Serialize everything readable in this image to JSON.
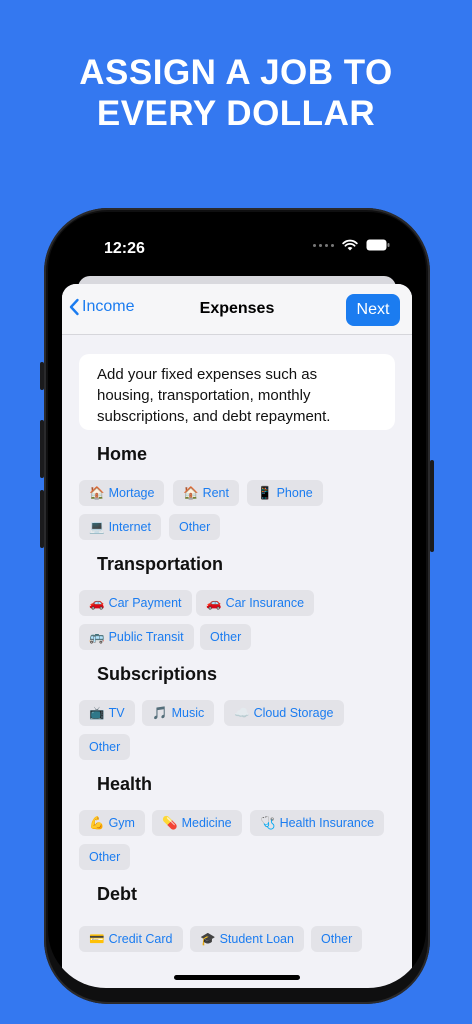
{
  "headline": {
    "line1": "ASSIGN A JOB TO",
    "line2": "EVERY DOLLAR"
  },
  "status_bar": {
    "time": "12:26"
  },
  "nav": {
    "back_label": "Income",
    "title": "Expenses",
    "next_label": "Next"
  },
  "intro_text": "Add your fixed expenses such as housing, transportation, monthly subscriptions, and debt repayment.",
  "sections": [
    {
      "title": "Home",
      "chips": [
        {
          "icon": "🏠",
          "label": "Mortage"
        },
        {
          "icon": "🏠",
          "label": "Rent"
        },
        {
          "icon": "📱",
          "label": "Phone"
        },
        {
          "icon": "💻",
          "label": "Internet"
        },
        {
          "icon": "",
          "label": "Other"
        }
      ]
    },
    {
      "title": "Transportation",
      "chips": [
        {
          "icon": "🚗",
          "label": "Car Payment"
        },
        {
          "icon": "🚗",
          "label": "Car Insurance"
        },
        {
          "icon": "🚌",
          "label": "Public Transit"
        },
        {
          "icon": "",
          "label": "Other"
        }
      ]
    },
    {
      "title": "Subscriptions",
      "chips": [
        {
          "icon": "📺",
          "label": "TV"
        },
        {
          "icon": "🎵",
          "label": "Music"
        },
        {
          "icon": "☁️",
          "label": "Cloud Storage"
        },
        {
          "icon": "",
          "label": "Other"
        }
      ]
    },
    {
      "title": "Health",
      "chips": [
        {
          "icon": "💪",
          "label": "Gym"
        },
        {
          "icon": "💊",
          "label": "Medicine"
        },
        {
          "icon": "🩺",
          "label": "Health Insurance"
        },
        {
          "icon": "",
          "label": "Other"
        }
      ]
    },
    {
      "title": "Debt",
      "chips": [
        {
          "icon": "💳",
          "label": "Credit Card"
        },
        {
          "icon": "🎓",
          "label": "Student Loan"
        },
        {
          "icon": "",
          "label": "Other"
        }
      ]
    }
  ],
  "colors": {
    "background": "#3478f0",
    "accent": "#1b7cf0",
    "chip_bg": "#e3e3e8",
    "sheet_bg": "#f2f2f7"
  }
}
